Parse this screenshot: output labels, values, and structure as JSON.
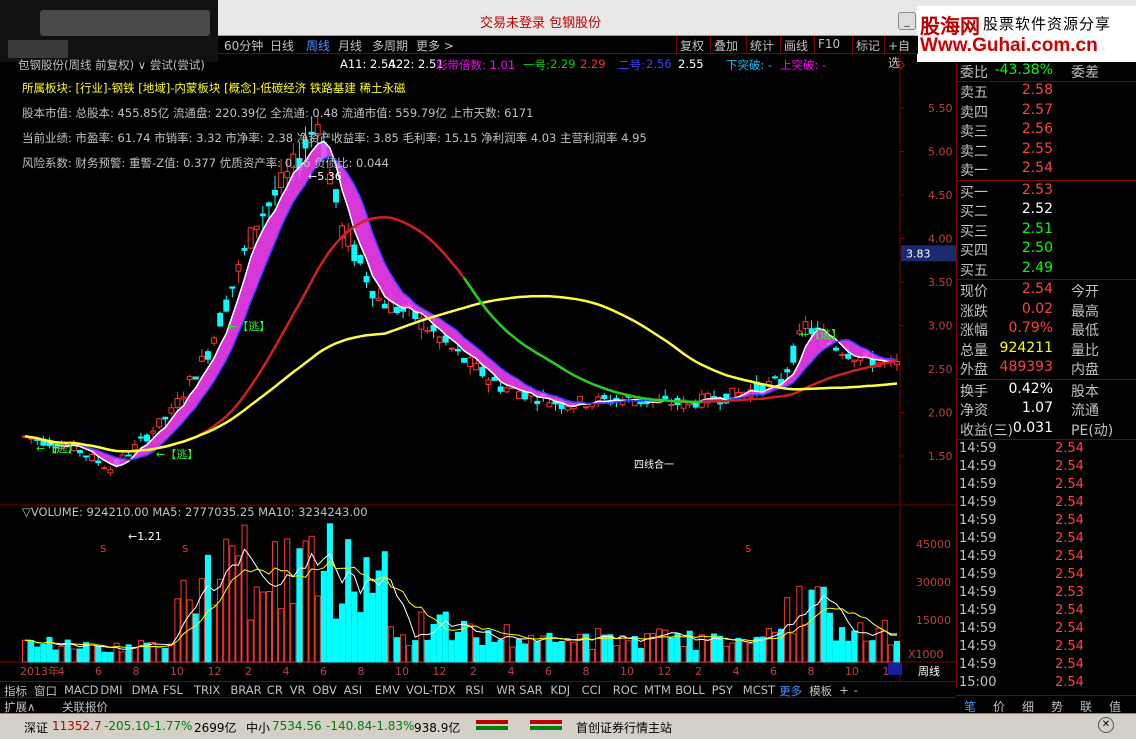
{
  "title": {
    "text": "交易未登录  包钢股份"
  },
  "brand": {
    "name": "股海网",
    "tagline": "股票软件资源分享",
    "url": "Www.Guhai.com.cn"
  },
  "toolbar": {
    "items": [
      "60分钟",
      "日线",
      "周线",
      "月线",
      "多周期",
      "更多 >"
    ],
    "right": [
      "复权",
      "叠加",
      "统计",
      "画线",
      "F10",
      "标记",
      "+自选"
    ],
    "active": "周线"
  },
  "infoline": {
    "a11": "A11: 2.54",
    "a22": "A22: 2.51",
    "caidai": "彩带倍数: 1.01",
    "yihao_lbl": "一号:",
    "yihao_v1": "2.29",
    "yihao_v2": "2.29",
    "erhao_lbl": "二号:",
    "erhao_v1": "2.56",
    "erhao_v2": "2.55",
    "xiatupo": "下突破: -",
    "shangtupo": "上突破: -"
  },
  "header_line": "包钢股份(周线 前复权) ∨ 尝试(尝试)",
  "panel": {
    "l1_a": "所属板块:",
    "l1_b": "[行业]-钢铁 [地域]-内蒙板块 [概念]-低碳经济 铁路基建 稀土永磁",
    "l2": "股本市值: 总股本: 455.85亿 流通盘: 220.39亿 全流通: 0.48 流通市值: 559.79亿 上市天数: 6171",
    "l3": "当前业绩: 市盈率: 61.74 市销率: 3.32 市净率: 2.38 净资产收益率: 3.85 毛利率: 15.15 净利润率 4.03 主营利润率 4.95",
    "l4": "风险系数: 财务预警: 重警-Z值: 0.377 优质资产率: 0.56 负债比: 0.044"
  },
  "volinfo": "▽VOLUME: 924210.00  MA5: 2777035.25  MA10: 3234243.00",
  "annotations": {
    "escape": "←【逃】",
    "high": "←5.36",
    "low": "←1.21",
    "s": "S",
    "cx": "四线合一"
  },
  "price_axis": [
    "5.50",
    "5.00",
    "4.50",
    "4.00",
    "3.50",
    "3.00",
    "2.50",
    "2.00",
    "1.50"
  ],
  "price_marker": "3.83",
  "vol_axis": [
    "45000",
    "30000",
    "15000"
  ],
  "vol_unit": "X1000",
  "x_axis": [
    "2013年",
    "4",
    "6",
    "8",
    "10",
    "12",
    "2",
    "4",
    "6",
    "8",
    "10",
    "12",
    "2",
    "4",
    "6",
    "8",
    "10",
    "12",
    "2",
    "4",
    "6",
    "8",
    "10",
    "12"
  ],
  "period_btn": "周线",
  "quote": {
    "weibi": {
      "l": "委比",
      "v": "-43.38%",
      "r": "委差"
    },
    "sells": [
      {
        "l": "卖五",
        "v": "2.58"
      },
      {
        "l": "卖四",
        "v": "2.57"
      },
      {
        "l": "卖三",
        "v": "2.56"
      },
      {
        "l": "卖二",
        "v": "2.55"
      },
      {
        "l": "卖一",
        "v": "2.54"
      }
    ],
    "buys": [
      {
        "l": "买一",
        "v": "2.53"
      },
      {
        "l": "买二",
        "v": "2.52"
      },
      {
        "l": "买三",
        "v": "2.51"
      },
      {
        "l": "买四",
        "v": "2.50"
      },
      {
        "l": "买五",
        "v": "2.49"
      }
    ],
    "stats": [
      {
        "l": "现价",
        "v": "2.54",
        "r": "今开"
      },
      {
        "l": "涨跌",
        "v": "0.02",
        "r": "最高"
      },
      {
        "l": "涨幅",
        "v": "0.79%",
        "r": "最低"
      },
      {
        "l": "总量",
        "v": "924211",
        "r": "量比"
      },
      {
        "l": "外盘",
        "v": "489393",
        "r": "内盘"
      }
    ],
    "stats2": [
      {
        "l": "换手",
        "v": "0.42%",
        "r": "股本"
      },
      {
        "l": "净资",
        "v": "1.07",
        "r": "流通"
      },
      {
        "l": "收益(三)",
        "v": "0.031",
        "r": "PE(动)"
      }
    ],
    "ticks": [
      {
        "t": "14:59",
        "p": "2.54"
      },
      {
        "t": "14:59",
        "p": "2.54"
      },
      {
        "t": "14:59",
        "p": "2.54"
      },
      {
        "t": "14:59",
        "p": "2.54"
      },
      {
        "t": "14:59",
        "p": "2.54"
      },
      {
        "t": "14:59",
        "p": "2.54"
      },
      {
        "t": "14:59",
        "p": "2.54"
      },
      {
        "t": "14:59",
        "p": "2.54"
      },
      {
        "t": "14:59",
        "p": "2.53"
      },
      {
        "t": "14:59",
        "p": "2.54"
      },
      {
        "t": "14:59",
        "p": "2.54"
      },
      {
        "t": "14:59",
        "p": "2.54"
      },
      {
        "t": "14:59",
        "p": "2.54"
      },
      {
        "t": "15:00",
        "p": "2.54"
      }
    ],
    "tabs": [
      "笔",
      "价",
      "细",
      "势",
      "联",
      "值"
    ]
  },
  "indicators": [
    "指标",
    "窗口",
    "MACD",
    "DMI",
    "DMA",
    "FSL",
    "TRIX",
    "BRAR",
    "CR",
    "VR",
    "OBV",
    "ASI",
    "EMV",
    "VOL-TDX",
    "RSI",
    "WR",
    "SAR",
    "KDJ",
    "CCI",
    "ROC",
    "MTM",
    "BOLL",
    "PSY",
    "MCST",
    "更多",
    "模板",
    "+",
    "-"
  ],
  "expand": {
    "a": "扩展∧",
    "b": "关联报价"
  },
  "status": {
    "sz": "深证",
    "sz_v": "11352.7",
    "sz_c": "-205.10",
    "sz_p": "-1.77%",
    "sz_a": "2699亿",
    "zx": "中小",
    "zx_v": "7534.56",
    "zx_c": "-140.84",
    "zx_p": "-1.83%",
    "zx_a": "938.9亿",
    "broker": "首创证券行情主站"
  }
}
